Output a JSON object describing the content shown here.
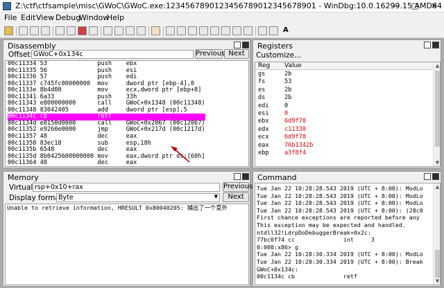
{
  "title": "Z:\\ctf\\ctfsample\\misc\\GWoC\\GWoC.exe:1234567890123456789012345678901 - WinDbg:10.0.16299.15 AMD64",
  "menu": [
    "File",
    "Edit",
    "View",
    "Debug",
    "Window",
    "Help"
  ],
  "toolbar_text": "A",
  "disasm": {
    "title": "Disassembly",
    "offset_label": "Offset:",
    "offset_value": "GWoC+0x134c",
    "prev": "Previous",
    "next": "Next",
    "rows": [
      "00c11334 53              push    ebx",
      "00c11335 56              push    esi",
      "00c11336 57              push    edi",
      "00c11337 c745fc00000000  mov     dword ptr [ebp-4],0",
      "00c1133e 8b4d08          mov     ecx,dword ptr [ebp+8]",
      "00c11341 6a33            push    33h",
      "00c11343 e800000000      call    GWoC+0x1348 (00c11348)",
      "00c11348 83042405        add     dword ptr [esp],5",
      "00c1134c cb              retf",
      "00c1134d e8150d0000      call    GWoC+0x2067 (00c12067)",
      "00c11352 e9260e0000      jmp     GWoC+0x217d (00c1217d)",
      "00c11357 48              dec     eax",
      "00c11358 83ec18          sub     esp,18h",
      "00c1135b 6548            dec     eax",
      "00c1135d 8b0425600000000 mov     eax,dword ptr ds:[60h]",
      "00c11364 48              dec     eax"
    ],
    "highlight_row": 8
  },
  "registers": {
    "title": "Registers",
    "customize": "Customize...",
    "col_reg": "Reg",
    "col_value": "Value",
    "rows": [
      {
        "reg": "gs",
        "value": "2b",
        "changed": false
      },
      {
        "reg": "fs",
        "value": "53",
        "changed": false
      },
      {
        "reg": "es",
        "value": "2b",
        "changed": false
      },
      {
        "reg": "ds",
        "value": "2b",
        "changed": false
      },
      {
        "reg": "edi",
        "value": "0",
        "changed": false
      },
      {
        "reg": "esi",
        "value": "0",
        "changed": true
      },
      {
        "reg": "ebx",
        "value": "6d9f78",
        "changed": true
      },
      {
        "reg": "edx",
        "value": "c11330",
        "changed": true
      },
      {
        "reg": "ecx",
        "value": "6d9f78",
        "changed": true
      },
      {
        "reg": "eax",
        "value": "76b1342b",
        "changed": true
      },
      {
        "reg": "ebp",
        "value": "a3f8f4",
        "changed": true
      }
    ]
  },
  "memory": {
    "title": "Memory",
    "virtual_label": "Virtual:",
    "virtual_value": "rsp+0x10+rax",
    "previous": "Previous",
    "format_label": "Display format:",
    "format_value": "Byte",
    "next": "Next",
    "content": "Unable to retrieve information, HRESULT 0x80040205: 捕出了一个意外"
  },
  "command": {
    "title": "Command",
    "lines": [
      "Tue Jan 22 10:28:28.543 2019 (UTC + 8:00): ModLo",
      "Tue Jan 22 10:28:28.543 2019 (UTC + 8:00): ModLo",
      "Tue Jan 22 10:28:28.543 2019 (UTC + 8:00): ModLo",
      "Tue Jan 22 10:28:28.543 2019 (UTC + 8:00): (28c0",
      "First chance exceptions are reported before any",
      "This exception may be expected and handled.",
      "ntdll32!LdrpDoDebuggerBreak+0x2c:",
      "77bc0f74 cc              int     3",
      "0:000:x86> g",
      "Tue Jan 22 10:28:30.334 2019 (UTC + 8:00): ModLo",
      "Tue Jan 22 10:28:30.334 2019 (UTC + 8:00): Break",
      "GWoC+0x134c:",
      "00c1134c cb              retf"
    ]
  },
  "colors": {
    "highlight": "#ff00ff",
    "changed_register": "#e00000",
    "arrow": "#c00000"
  }
}
